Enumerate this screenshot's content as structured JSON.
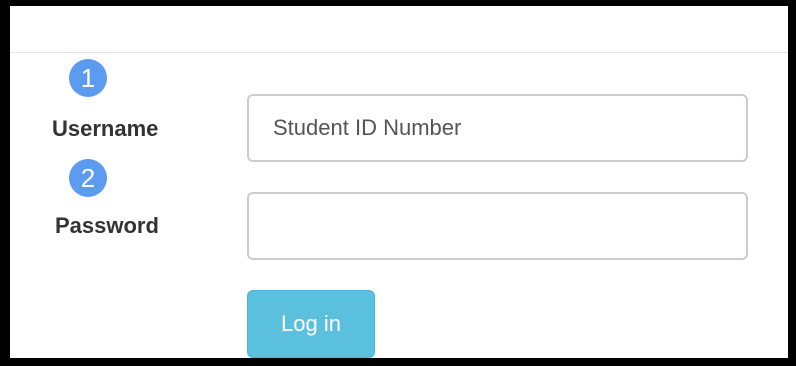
{
  "form": {
    "username": {
      "step_number": "1",
      "label": "Username",
      "placeholder": "Student ID Number",
      "value": ""
    },
    "password": {
      "step_number": "2",
      "label": "Password",
      "placeholder": "",
      "value": ""
    },
    "login_button_label": "Log in"
  },
  "colors": {
    "badge": "#5b9bf0",
    "button": "#5bc0de",
    "label_text": "#333333",
    "input_border": "#cccccc"
  }
}
